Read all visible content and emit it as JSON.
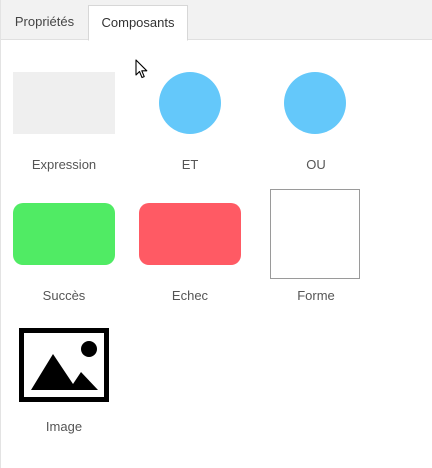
{
  "tabs": [
    {
      "label": "Propriétés",
      "active": false
    },
    {
      "label": "Composants",
      "active": true
    }
  ],
  "components": [
    {
      "label": "Expression",
      "icon": "rectangle-gray",
      "color": "#efefef"
    },
    {
      "label": "ET",
      "icon": "circle-blue",
      "color": "#64c8fa"
    },
    {
      "label": "OU",
      "icon": "circle-blue",
      "color": "#64c8fa"
    },
    {
      "label": "Succès",
      "icon": "rounded-rect-green",
      "color": "#50eb64"
    },
    {
      "label": "Echec",
      "icon": "rounded-rect-red",
      "color": "#ff5a64"
    },
    {
      "label": "Forme",
      "icon": "outlined-square",
      "color": "#9a9a9a"
    },
    {
      "label": "Image",
      "icon": "image-icon",
      "color": "#000000"
    }
  ]
}
